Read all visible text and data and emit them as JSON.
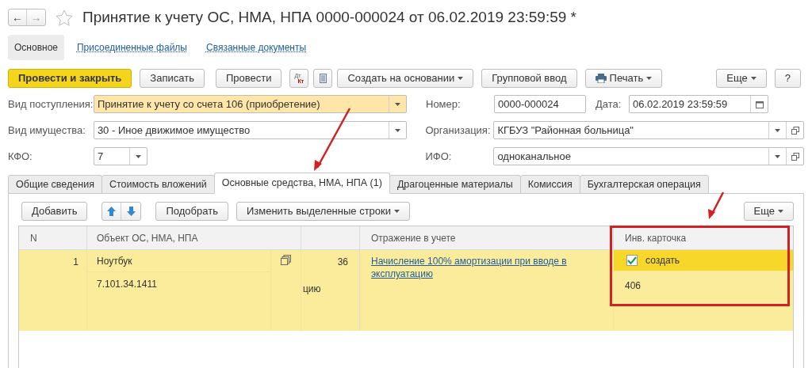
{
  "window": {
    "title": "Принятие к учету ОС, НМА, НПА 0000-000024 от 06.02.2019 23:59:59 *",
    "favorite": false
  },
  "nav": {
    "back": "←",
    "forward": "→"
  },
  "sections": [
    {
      "label": "Основное",
      "selected": true
    },
    {
      "label": "Присоединенные файлы",
      "selected": false
    },
    {
      "label": "Связанные документы",
      "selected": false
    }
  ],
  "toolbar": [
    {
      "kind": "primary",
      "label": "Провести и закрыть"
    },
    {
      "kind": "button",
      "label": "Записать"
    },
    {
      "kind": "button",
      "label": "Провести"
    },
    {
      "kind": "dtkt",
      "top": "Дт",
      "bottom": "Кт"
    },
    {
      "kind": "list"
    },
    {
      "kind": "dropdown",
      "label": "Создать на основании"
    },
    {
      "kind": "button",
      "label": "Групповой ввод"
    },
    {
      "kind": "print",
      "label": "Печать"
    }
  ],
  "toolbar_right": [
    {
      "kind": "dropdown",
      "label": "Еще"
    },
    {
      "kind": "button",
      "label": "?"
    }
  ],
  "fields": {
    "vid_postupleniya": {
      "label": "Вид поступления:",
      "value": "Принятие к учету со счета 106 (приобретение)",
      "highlighted": true
    },
    "vid_imushchestva": {
      "label": "Вид имущества:",
      "value": "30 - Иное движимое имущество"
    },
    "kfo": {
      "label": "КФО:",
      "value": "7"
    },
    "nomer": {
      "label": "Номер:",
      "value": "0000-000024"
    },
    "data": {
      "label": "Дата:",
      "value": "06.02.2019 23:59:59"
    },
    "organizaciya": {
      "label": "Организация:",
      "value": "КГБУЗ \"Районная больница\""
    },
    "ifo": {
      "label": "ИФО:",
      "value": "одноканальное"
    }
  },
  "tabs": [
    {
      "label": "Общие сведения",
      "selected": false
    },
    {
      "label": "Стоимость вложений",
      "selected": false
    },
    {
      "label": "Основные средства, НМА, НПА (1)",
      "selected": true
    },
    {
      "label": "Драгоценные материалы",
      "selected": false
    },
    {
      "label": "Комиссия",
      "selected": false
    },
    {
      "label": "Бухгалтерская операция",
      "selected": false
    }
  ],
  "table_toolbar": [
    {
      "kind": "button",
      "label": "Добавить"
    },
    {
      "kind": "updown"
    },
    {
      "kind": "button",
      "label": "Подобрать"
    },
    {
      "kind": "dropdown",
      "label": "Изменить выделенные строки"
    }
  ],
  "table_toolbar_right": {
    "label": "Еще"
  },
  "table": {
    "columns": [
      "N",
      "Объект ОС, НМА, НПА",
      "Отражение в учете",
      "Инв. карточка"
    ],
    "rows": [
      {
        "selected": true,
        "n": "1",
        "object": "Ноутбук",
        "account": "7.101.34.1411",
        "column_3": "36",
        "column_3_line_2": "цию",
        "reflection": "Начисление 100% амортизации при вводе в эксплуатацию",
        "card_checked": true,
        "card_label": "создать",
        "card_number": "406"
      }
    ]
  },
  "annotations": [
    {
      "kind": "arrow"
    },
    {
      "kind": "arrow"
    },
    {
      "kind": "frame"
    }
  ]
}
